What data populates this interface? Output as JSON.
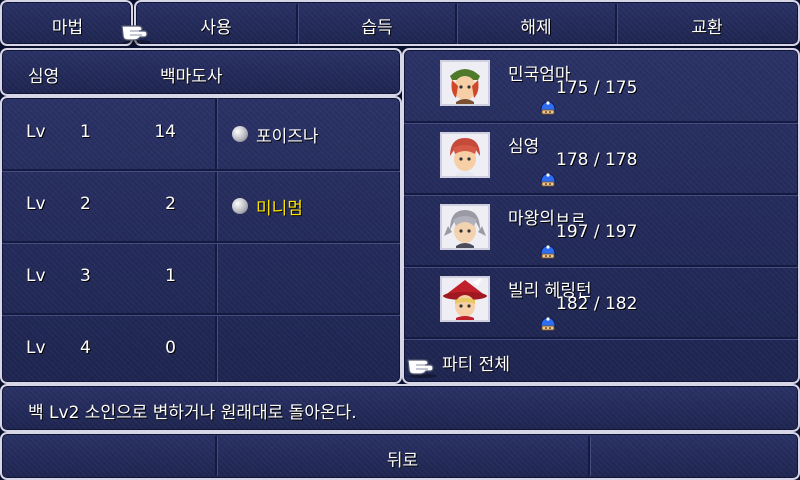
{
  "menu": {
    "items": [
      "마법",
      "사용",
      "습득",
      "해제",
      "교환"
    ]
  },
  "caster": {
    "name": "심영",
    "job": "백마도사"
  },
  "levels": [
    {
      "label": "Lv",
      "level": "1",
      "charges": "14"
    },
    {
      "label": "Lv",
      "level": "2",
      "charges": "2"
    },
    {
      "label": "Lv",
      "level": "3",
      "charges": "1"
    },
    {
      "label": "Lv",
      "level": "4",
      "charges": "0"
    }
  ],
  "spells": [
    {
      "name": "포이즈나",
      "highlight": false
    },
    {
      "name": "미니멈",
      "highlight": true
    }
  ],
  "party": [
    {
      "name": "민국엄마",
      "hp": "175 / 175"
    },
    {
      "name": "심영",
      "hp": "178 / 178"
    },
    {
      "name": "마왕의ㅂㄹ",
      "hp": "197 / 197"
    },
    {
      "name": "빌리 헤링턴",
      "hp": "182 / 182"
    }
  ],
  "party_all_label": "파티 전체",
  "description": "백 Lv2 소인으로 변하거나 원래대로 돌아온다.",
  "back_label": "뒤로",
  "colors": {
    "window_bg": "#232a5b",
    "border": "#d6d6e6",
    "highlight_text": "#ffe600",
    "mini_status_icon": "#1f5fe0"
  },
  "icons": {
    "pointer": "pointing-hand-icon",
    "spell_orb": "white-magic-orb-icon",
    "status": "mini-status-icon"
  }
}
